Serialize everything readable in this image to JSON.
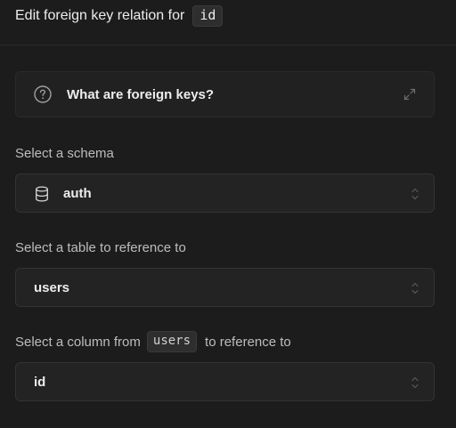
{
  "header": {
    "title": "Edit foreign key relation for",
    "column_chip": "id"
  },
  "info": {
    "title": "What are foreign keys?",
    "icon": "question-circle-icon",
    "expand_icon": "expand-arrows-icon"
  },
  "schema": {
    "label": "Select a schema",
    "value": "auth",
    "icon": "database-icon"
  },
  "table": {
    "label": "Select a table to reference to",
    "value": "users"
  },
  "column": {
    "label_prefix": "Select a column from",
    "label_chip": "users",
    "label_suffix": "to reference to",
    "value": "id"
  },
  "colors": {
    "background": "#1c1c1c",
    "surface": "#232323",
    "border": "#333333",
    "text": "#ededed",
    "muted_text": "#bdbdbd"
  }
}
